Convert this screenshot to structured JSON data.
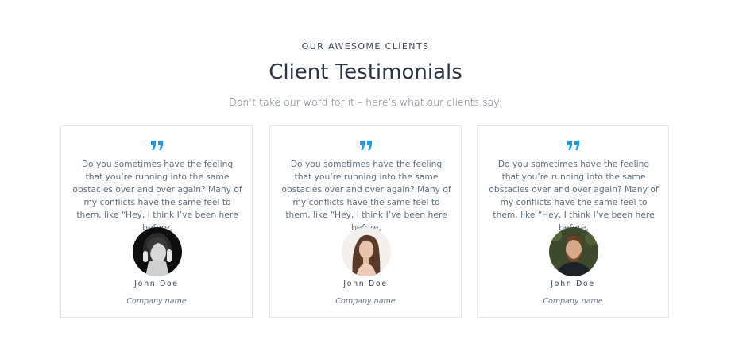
{
  "section": {
    "eyebrow": "OUR AWESOME CLIENTS",
    "title": "Client Testimonials",
    "subtitle": "Don’t take our word for it – here’s what our clients say:"
  },
  "colors": {
    "accent": "#1e9be0",
    "border": "#e3e6ea",
    "heading": "#2c3342"
  },
  "testimonials": [
    {
      "quote": "Do you sometimes have the feeling that you’re running into the same obstacles over and over again? Many of my conflicts have the same feel to them, like “Hey, I think I’ve been here before,",
      "name": "John Doe",
      "company": "Company name",
      "avatar_icon": "avatar-woman-bw"
    },
    {
      "quote": "Do you sometimes have the feeling that you’re running into the same obstacles over and over again? Many of my conflicts have the same feel to them, like “Hey, I think I’ve been here before,",
      "name": "John Doe",
      "company": "Company name",
      "avatar_icon": "avatar-woman-color"
    },
    {
      "quote": "Do you sometimes have the feeling that you’re running into the same obstacles over and over again? Many of my conflicts have the same feel to them, like “Hey, I think I’ve been here before,",
      "name": "John Doe",
      "company": "Company name",
      "avatar_icon": "avatar-bearded-man"
    }
  ]
}
